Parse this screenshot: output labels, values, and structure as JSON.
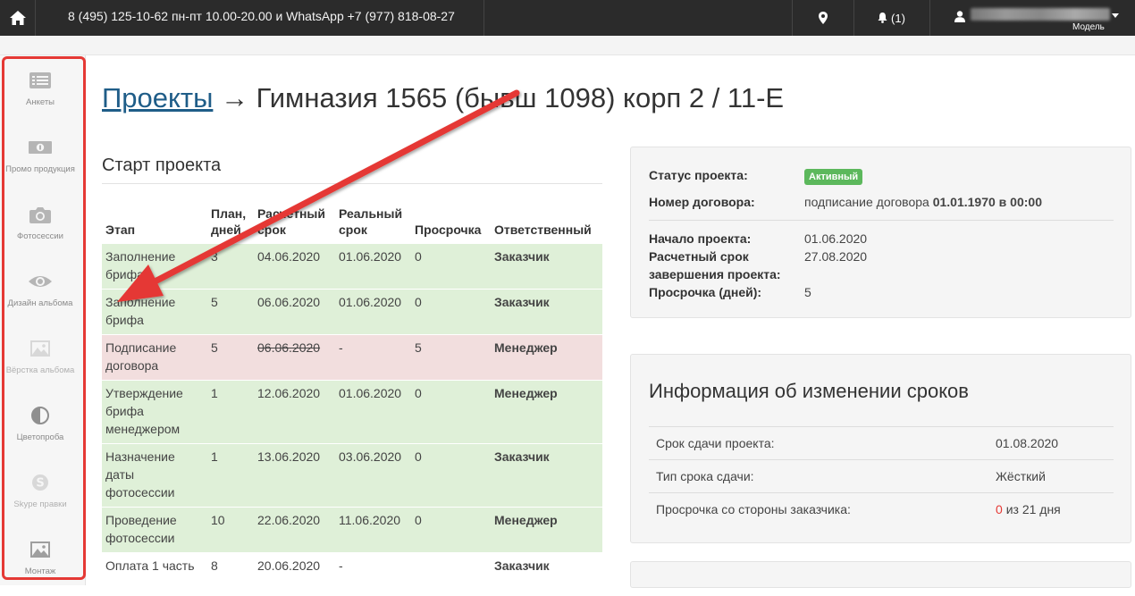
{
  "topbar": {
    "phone_text": "8 (495) 125-10-62 пн-пт 10.00-20.00 и WhatsApp +7 (977) 818-08-27",
    "notifications": "(1)",
    "user_role": "Модель"
  },
  "sidebar": {
    "items": [
      {
        "label": "Анкеты",
        "icon": "list-icon"
      },
      {
        "label": "Промо продукция",
        "icon": "money-icon"
      },
      {
        "label": "Фотосессии",
        "icon": "camera-icon"
      },
      {
        "label": "Дизайн альбома",
        "icon": "eye-icon"
      },
      {
        "label": "Вёрстка альбома",
        "icon": "picture-icon"
      },
      {
        "label": "Цветопроба",
        "icon": "contrast-icon"
      },
      {
        "label": "Skype правки",
        "icon": "skype-icon"
      },
      {
        "label": "Монтаж",
        "icon": "picture-icon"
      }
    ]
  },
  "page": {
    "breadcrumb_link": "Проекты",
    "arrow": "→",
    "title": "Гимназия 1565 (бывш 1098) корп 2 / 11-Е"
  },
  "stages": {
    "section_title": "Старт проекта",
    "headers": [
      "Этап",
      "План, дней",
      "Расчетный срок",
      "Реальный срок",
      "Просрочка",
      "Ответственный"
    ],
    "rows": [
      {
        "stage": "Заполнение брифа ...",
        "plan": "3",
        "est": "04.06.2020",
        "real": "01.06.2020",
        "delay": "0",
        "owner": "Заказчик",
        "status": "ok"
      },
      {
        "stage": "Заполнение брифа",
        "plan": "5",
        "est": "06.06.2020",
        "real": "01.06.2020",
        "delay": "0",
        "owner": "Заказчик",
        "status": "ok"
      },
      {
        "stage": "Подписание договора",
        "plan": "5",
        "est": "06.06.2020",
        "real": "-",
        "delay": "5",
        "owner": "Менеджер",
        "status": "bad"
      },
      {
        "stage": "Утверждение брифа менеджером",
        "plan": "1",
        "est": "12.06.2020",
        "real": "01.06.2020",
        "delay": "0",
        "owner": "Менеджер",
        "status": "ok"
      },
      {
        "stage": "Назначение даты фотосессии",
        "plan": "1",
        "est": "13.06.2020",
        "real": "03.06.2020",
        "delay": "0",
        "owner": "Заказчик",
        "status": "ok"
      },
      {
        "stage": "Проведение фотосессии",
        "plan": "10",
        "est": "22.06.2020",
        "real": "11.06.2020",
        "delay": "0",
        "owner": "Менеджер",
        "status": "ok"
      },
      {
        "stage": "Оплата 1 часть",
        "plan": "8",
        "est": "20.06.2020",
        "real": "-",
        "delay": "",
        "owner": "Заказчик",
        "status": "plain"
      }
    ]
  },
  "status_panel": {
    "status_label": "Статус проекта:",
    "status_value": "Активный",
    "contract_label": "Номер договора:",
    "contract_value_prefix": "подписание договора",
    "contract_value_date": "01.01.1970 в 00:00",
    "start_label": "Начало проекта:",
    "start_value": "01.06.2020",
    "est_end_label": "Расчетный срок завершения проекта:",
    "est_end_value": "27.08.2020",
    "delay_label": "Просрочка (дней):",
    "delay_value": "5"
  },
  "deadline_panel": {
    "title": "Информация об изменении сроков",
    "rows": [
      {
        "label": "Срок сдачи проекта:",
        "value": "01.08.2020"
      },
      {
        "label": "Тип срока сдачи:",
        "value": "Жёсткий"
      },
      {
        "label": "Просрочка со стороны заказчика:",
        "value_red": "0",
        "value_rest": "из 21 дня"
      }
    ]
  },
  "colors": {
    "accent_red": "#e53935",
    "row_ok": "#dff0d8",
    "row_bad": "#f2dede",
    "badge_green": "#5cb85c",
    "navbar": "#2b2b2b"
  }
}
